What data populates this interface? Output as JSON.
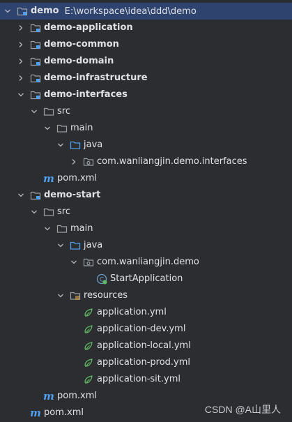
{
  "tree": [
    {
      "label": "demo",
      "path": "E:\\workspace\\idea\\ddd\\demo",
      "bold": true,
      "expanded": true,
      "icon": "module-folder-icon",
      "level": 0,
      "selected": true
    },
    {
      "label": "demo-application",
      "bold": true,
      "expanded": false,
      "icon": "module-folder-icon",
      "level": 1
    },
    {
      "label": "demo-common",
      "bold": true,
      "expanded": false,
      "icon": "module-folder-icon",
      "level": 1
    },
    {
      "label": "demo-domain",
      "bold": true,
      "expanded": false,
      "icon": "module-folder-icon",
      "level": 1
    },
    {
      "label": "demo-infrastructure",
      "bold": true,
      "expanded": false,
      "icon": "module-folder-icon",
      "level": 1
    },
    {
      "label": "demo-interfaces",
      "bold": true,
      "expanded": true,
      "icon": "module-folder-icon",
      "level": 1
    },
    {
      "label": "src",
      "expanded": true,
      "icon": "folder-icon",
      "level": 2
    },
    {
      "label": "main",
      "expanded": true,
      "icon": "folder-icon",
      "level": 3
    },
    {
      "label": "java",
      "expanded": true,
      "icon": "source-folder-icon",
      "level": 4
    },
    {
      "label": "com.wanliangjin.demo.interfaces",
      "expanded": false,
      "icon": "package-icon",
      "level": 5
    },
    {
      "label": "pom.xml",
      "icon": "maven-icon",
      "level": 2
    },
    {
      "label": "demo-start",
      "bold": true,
      "expanded": true,
      "icon": "module-folder-icon",
      "level": 1
    },
    {
      "label": "src",
      "expanded": true,
      "icon": "folder-icon",
      "level": 2
    },
    {
      "label": "main",
      "expanded": true,
      "icon": "folder-icon",
      "level": 3
    },
    {
      "label": "java",
      "expanded": true,
      "icon": "source-folder-icon",
      "level": 4
    },
    {
      "label": "com.wanliangjin.demo",
      "expanded": true,
      "icon": "package-icon",
      "level": 5
    },
    {
      "label": "StartApplication",
      "icon": "spring-class-icon",
      "level": 6
    },
    {
      "label": "resources",
      "expanded": true,
      "icon": "resources-folder-icon",
      "level": 4
    },
    {
      "label": "application.yml",
      "icon": "spring-config-icon",
      "level": 5
    },
    {
      "label": "application-dev.yml",
      "icon": "spring-config-icon",
      "level": 5
    },
    {
      "label": "application-local.yml",
      "icon": "spring-config-icon",
      "level": 5
    },
    {
      "label": "application-prod.yml",
      "icon": "spring-config-icon",
      "level": 5
    },
    {
      "label": "application-sit.yml",
      "icon": "spring-config-icon",
      "level": 5
    },
    {
      "label": "pom.xml",
      "icon": "maven-icon",
      "level": 2
    },
    {
      "label": "pom.xml",
      "icon": "maven-icon",
      "level": 1
    }
  ],
  "colors": {
    "background": "#2b2d30",
    "selection": "#2e436e",
    "text": "#dfe1e5",
    "folder": "#9aa0a6",
    "module_dot": "#4e9ff0",
    "source_folder": "#4e9ff0",
    "spring": "#5fb865"
  },
  "watermark": "CSDN @A山里人"
}
